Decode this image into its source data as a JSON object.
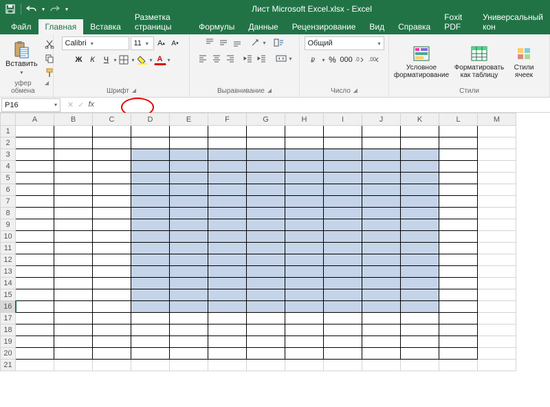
{
  "titlebar": {
    "title": "Лист Microsoft Excel.xlsx  -  Excel",
    "qat": {
      "save": "save-icon",
      "undo": "undo-icon",
      "redo": "redo-icon"
    }
  },
  "tabs": [
    {
      "label": "Файл",
      "active": false
    },
    {
      "label": "Главная",
      "active": true
    },
    {
      "label": "Вставка",
      "active": false
    },
    {
      "label": "Разметка страницы",
      "active": false
    },
    {
      "label": "Формулы",
      "active": false
    },
    {
      "label": "Данные",
      "active": false
    },
    {
      "label": "Рецензирование",
      "active": false
    },
    {
      "label": "Вид",
      "active": false
    },
    {
      "label": "Справка",
      "active": false
    },
    {
      "label": "Foxit PDF",
      "active": false
    },
    {
      "label": "Универсальный кон",
      "active": false
    }
  ],
  "ribbon": {
    "clipboard": {
      "paste": "Вставить",
      "label": "уфер обмена"
    },
    "font": {
      "name": "Calibri",
      "size": "11",
      "bold": "Ж",
      "italic": "К",
      "underline": "Ч",
      "label": "Шрифт"
    },
    "align": {
      "label": "Выравнивание"
    },
    "number": {
      "format": "Общий",
      "label": "Число"
    },
    "styles": {
      "cond": "Условное форматирование",
      "table": "Форматировать как таблицу",
      "cell": "Стили ячеек",
      "label": "Стили"
    }
  },
  "fxbar": {
    "namebox": "P16",
    "cancel": "✕",
    "confirm": "✓",
    "fx": "fx",
    "value": ""
  },
  "grid": {
    "cols": [
      "A",
      "B",
      "C",
      "D",
      "E",
      "F",
      "G",
      "H",
      "I",
      "J",
      "K",
      "L",
      "M"
    ],
    "rows": 21,
    "active_row": 16,
    "selection": {
      "from_col": "D",
      "to_col": "K",
      "from_row": 3,
      "to_row": 16
    },
    "bordered": {
      "from_col": "A",
      "to_col": "L",
      "from_row": 1,
      "to_row": 20
    }
  }
}
